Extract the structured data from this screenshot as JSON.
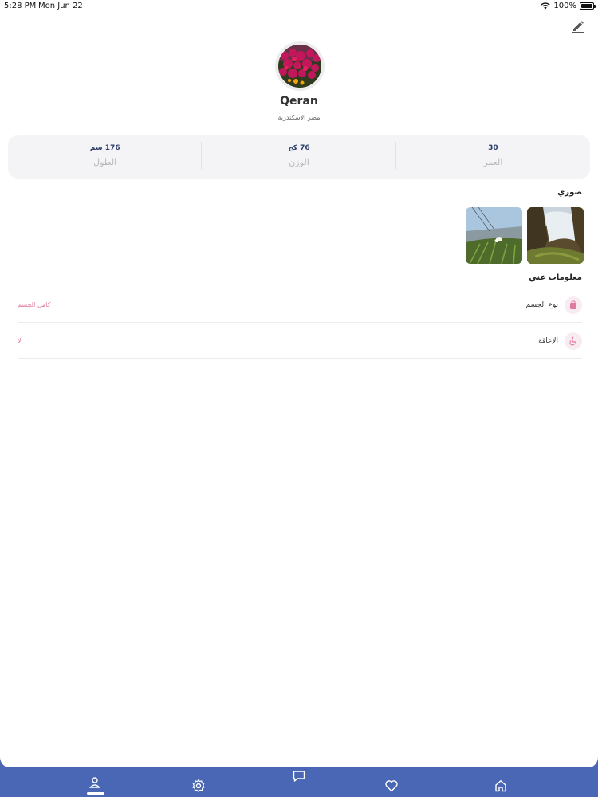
{
  "status_bar": {
    "time": "5:28 PM",
    "date": "Mon Jun 22",
    "battery": "100%"
  },
  "profile": {
    "name": "Qeran",
    "location": "مصر الاسكندرية"
  },
  "stats": [
    {
      "value": "30",
      "label": "العمر"
    },
    {
      "value": "76 كج",
      "label": "الوزن"
    },
    {
      "value": "176 سم",
      "label": "الطول"
    }
  ],
  "photos_section": {
    "title": "صوري"
  },
  "about_section": {
    "title": "معلومات عني",
    "rows": [
      {
        "icon": "body-type-icon",
        "label": "نوع الجسم",
        "value": "كامل الجسم"
      },
      {
        "icon": "wheelchair-icon",
        "label": "الإعاقة",
        "value": "لا"
      }
    ]
  },
  "nav": {
    "items": [
      "profile-icon",
      "settings-icon",
      "chat-icon",
      "heart-icon",
      "home-icon"
    ],
    "active": "profile-icon",
    "color": "#4a67b5"
  },
  "colors": {
    "accent_pink": "#e07a9f",
    "stat_value": "#2e3d6b",
    "nav_bg": "#4a67b5"
  }
}
